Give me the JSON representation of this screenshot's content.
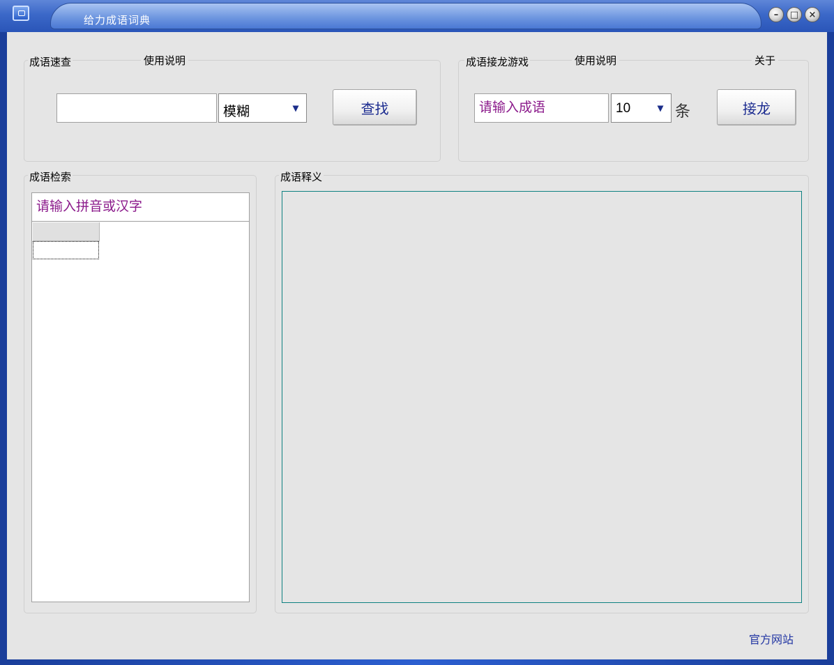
{
  "window": {
    "title": "给力成语词典",
    "minimize_symbol": "–",
    "maximize_symbol": "□",
    "close_symbol": "×"
  },
  "quick_search": {
    "group_label": "成语速查",
    "help_link": "使用说明",
    "input_value": "",
    "mode_select": "模糊",
    "dropdown_arrow": "▾",
    "search_button": "查找"
  },
  "solitaire": {
    "group_label": "成语接龙游戏",
    "help_link": "使用说明",
    "about_link": "关于",
    "input_placeholder": "请输入成语",
    "count_select": "10",
    "dropdown_arrow": "▾",
    "unit_label": "条",
    "play_button": "接龙"
  },
  "idiom_search": {
    "group_label": "成语检索",
    "input_placeholder": "请输入拼音或汉字"
  },
  "definition": {
    "group_label": "成语释义"
  },
  "footer": {
    "official_site": "官方网站"
  },
  "colors": {
    "titlebar_blue": "#3b68c8",
    "client_bg": "#e5e5e5",
    "placeholder_purple": "#8b1a8b",
    "button_text_blue": "#1a2a8f",
    "memo_border_teal": "#0d8080"
  }
}
